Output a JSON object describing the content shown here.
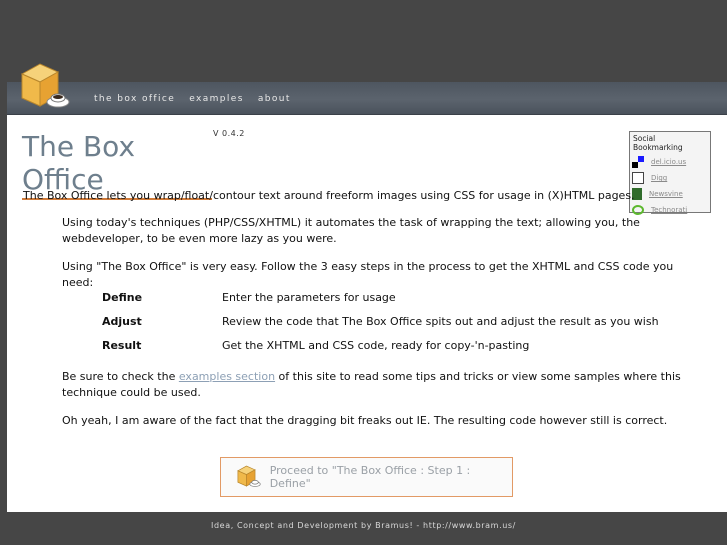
{
  "nav": {
    "items": [
      "the box office",
      "examples",
      "about"
    ]
  },
  "header": {
    "title": "The Box Office",
    "version": "V 0.4.2"
  },
  "content": {
    "intro": "The Box Office lets you wrap/float/contour text around freeform images using CSS for usage in (X)HTML pages.",
    "para1": "Using today's techniques (PHP/CSS/XHTML) it automates the task of wrapping the text; allowing you, the webdeveloper, to be even more lazy as you were.",
    "para2": "Using \"The Box Office\" is very easy. Follow the 3 easy steps in the process to get the XHTML and CSS code you need:",
    "steps": [
      {
        "name": "Define",
        "desc": "Enter the parameters for usage"
      },
      {
        "name": "Adjust",
        "desc": "Review the code that The Box Office spits out and adjust the result as you wish"
      },
      {
        "name": "Result",
        "desc": "Get the XHTML and CSS code, ready for copy-'n-pasting"
      }
    ],
    "para3_before": "Be sure to check the ",
    "para3_link": "examples section",
    "para3_after": " of this site to read some tips and tricks or view some samples where this technique could be used.",
    "para4": "Oh yeah, I am aware of the fact that the dragging bit freaks out IE. The resulting code however still is correct."
  },
  "social": {
    "title": "Social Bookmarking",
    "links": [
      "del.icio.us",
      "Digg",
      "Newsvine",
      "Technorati"
    ]
  },
  "proceed_label": "Proceed to \"The Box Office : Step 1 : Define\"",
  "footer": "Idea, Concept and Development by Bramus! - http://www.bram.us/",
  "colors": {
    "accent": "#d07b3a",
    "title": "#6e7f8d",
    "background": "#464646"
  }
}
